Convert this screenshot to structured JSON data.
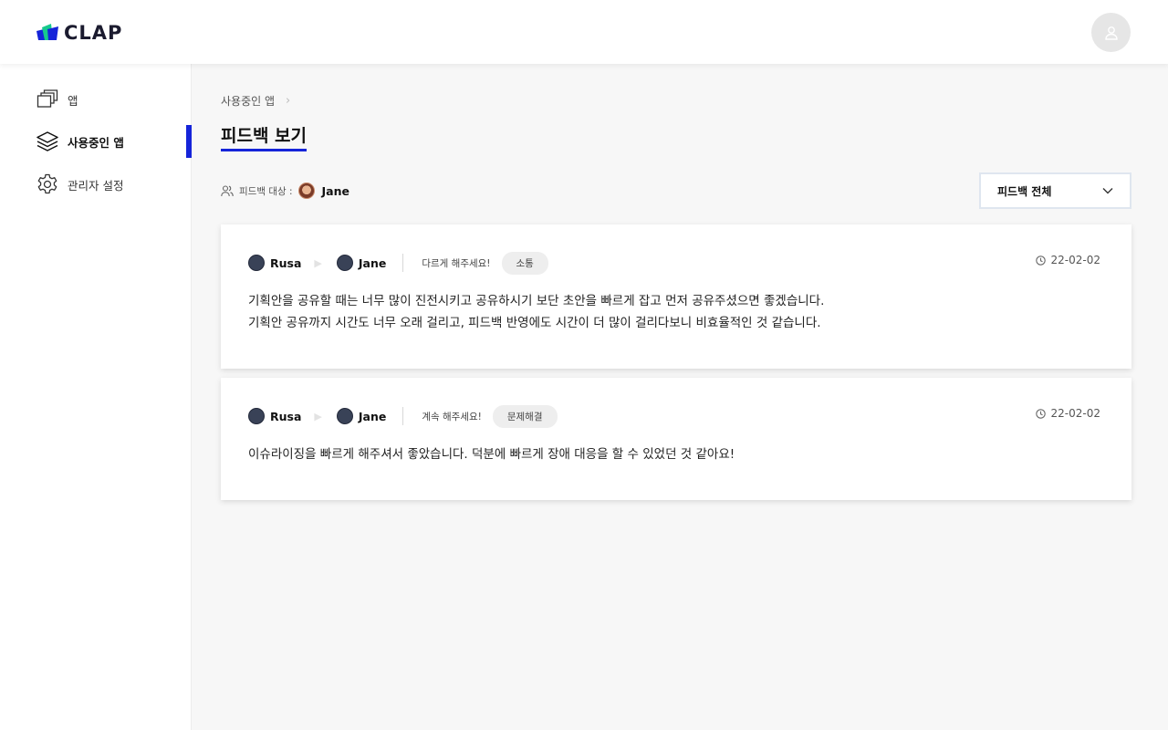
{
  "header": {
    "logo_text": "CLAP",
    "brand_colors": [
      "#1524d9",
      "#16c98d"
    ],
    "profile_icon": "user-icon"
  },
  "sidebar": {
    "items": [
      {
        "label": "앱",
        "icon": "windows-stack-icon",
        "active": false
      },
      {
        "label": "사용중인 앱",
        "icon": "layers-icon",
        "active": true
      },
      {
        "label": "관리자 설정",
        "icon": "gear-icon",
        "active": false
      }
    ],
    "active_color": "#1524d9"
  },
  "main": {
    "breadcrumb": [
      "사용중인 앱"
    ],
    "title": "피드백 보기",
    "target": {
      "label": "피드백 대상 :",
      "name": "Jane"
    },
    "filter": {
      "selected": "피드백 전체"
    },
    "feedbacks": [
      {
        "from": "Rusa",
        "to": "Jane",
        "prompt": "다르게 해주세요!",
        "tag": "소통",
        "date": "22-02-02",
        "lines": [
          "기획안을 공유할 때는 너무 많이 진전시키고 공유하시기 보단 초안을 빠르게 잡고 먼저 공유주셨으면 좋겠습니다.",
          "기획안 공유까지 시간도 너무 오래 걸리고, 피드백 반영에도 시간이 더 많이 걸리다보니 비효율적인 것 같습니다."
        ]
      },
      {
        "from": "Rusa",
        "to": "Jane",
        "prompt": "계속 해주세요!",
        "tag": "문제해결",
        "date": "22-02-02",
        "lines": [
          "이슈라이징을 빠르게 해주셔서 좋았습니다. 덕분에 빠르게 장애 대응을 할 수 있었던 것 같아요!"
        ]
      }
    ]
  }
}
